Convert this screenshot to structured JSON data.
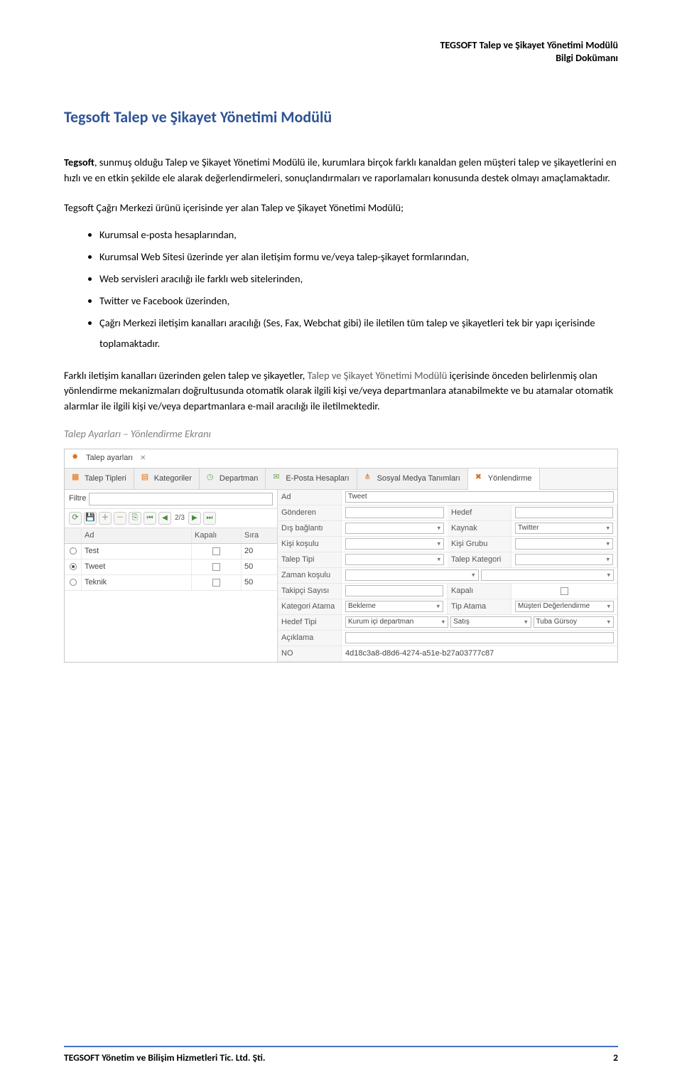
{
  "header": {
    "line1": "TEGSOFT Talep ve Şikayet Yönetimi Modülü",
    "line2": "Bilgi Dokümanı"
  },
  "title": "Tegsoft Talep ve Şikayet Yönetimi Modülü",
  "intro": {
    "brand": "Tegsoft",
    "rest": ", sunmuş olduğu Talep ve Şikayet Yönetimi Modülü ile, kurumlara birçok farklı kanaldan gelen müşteri talep ve şikayetlerini en hızlı ve en etkin şekilde ele alarak değerlendirmeleri, sonuçlandırmaları ve raporlamaları konusunda destek olmayı amaçlamaktadır."
  },
  "lead2": "Tegsoft Çağrı Merkezi ürünü içerisinde yer alan Talep ve Şikayet Yönetimi Modülü;",
  "bullets": [
    "Kurumsal e-posta hesaplarından,",
    "Kurumsal Web Sitesi üzerinde yer alan iletişim formu ve/veya talep-şikayet formlarından,",
    "Web servisleri aracılığı ile farklı web sitelerinden,",
    "Twitter ve Facebook üzerinden,",
    "Çağrı Merkezi iletişim kanalları aracılığı (Ses, Fax, Webchat gibi)  ile iletilen tüm talep ve şikayetleri tek bir yapı içerisinde toplamaktadır."
  ],
  "para3": {
    "pre": "Farklı iletişim kanalları üzerinden gelen talep ve şikayetler, ",
    "link": "Talep ve Şikayet Yönetimi Modülü",
    "post": " içerisinde önceden belirlenmiş olan yönlendirme mekanizmaları doğrultusunda otomatik olarak ilgili kişi ve/veya departmanlara atanabilmekte ve bu atamalar otomatik alarmlar ile ilgili kişi ve/veya departmanlara e-mail aracılığı ile iletilmektedir."
  },
  "caption": "Talep Ayarları – Yönlendirme Ekranı",
  "shot": {
    "toptab": "Talep ayarları",
    "tabs": [
      "Talep Tipleri",
      "Kategoriler",
      "Departman",
      "E-Posta Hesapları",
      "Sosyal Medya Tanımları",
      "Yönlendirme"
    ],
    "activeTabIndex": 5,
    "filtreLabel": "Filtre",
    "pager": "2/3",
    "gridHead": {
      "c0": "",
      "c1": "Ad",
      "c2": "Kapalı",
      "c3": "Sıra"
    },
    "gridRows": [
      {
        "sel": false,
        "ad": "Test",
        "kapali": false,
        "sira": "20"
      },
      {
        "sel": true,
        "ad": "Tweet",
        "kapali": false,
        "sira": "50"
      },
      {
        "sel": false,
        "ad": "Teknik",
        "kapali": false,
        "sira": "50"
      }
    ],
    "form": {
      "ad_l": "Ad",
      "ad_v": "Tweet",
      "gonderen_l": "Gönderen",
      "hedef_l": "Hedef",
      "disbag_l": "Dış bağlantı",
      "kaynak_l": "Kaynak",
      "kaynak_v": "Twitter",
      "kisikosulu_l": "Kişi koşulu",
      "kisigrubu_l": "Kişi Grubu",
      "taleptipi_l": "Talep Tipi",
      "talepkat_l": "Talep Kategori",
      "zamankosulu_l": "Zaman koşulu",
      "takipci_l": "Takipçi Sayısı",
      "kapali_l": "Kapalı",
      "kategoriatama_l": "Kategori Atama",
      "kategoriatama_v": "Bekleme",
      "tipatama_l": "Tip Atama",
      "tipatama_v": "Müşteri Değerlendirme",
      "hedeftipi_l": "Hedef Tipi",
      "hedeftipi_v1": "Kurum içi departman",
      "hedeftipi_v2": "Satış",
      "hedeftipi_v3": "Tuba Gürsoy",
      "aciklama_l": "Açıklama",
      "no_l": "NO",
      "no_v": "4d18c3a8-d8d6-4274-a51e-b27a03777c87"
    }
  },
  "footer": {
    "left": "TEGSOFT Yönetim ve Bilişim Hizmetleri Tic. Ltd. Şti.",
    "right": "2"
  }
}
